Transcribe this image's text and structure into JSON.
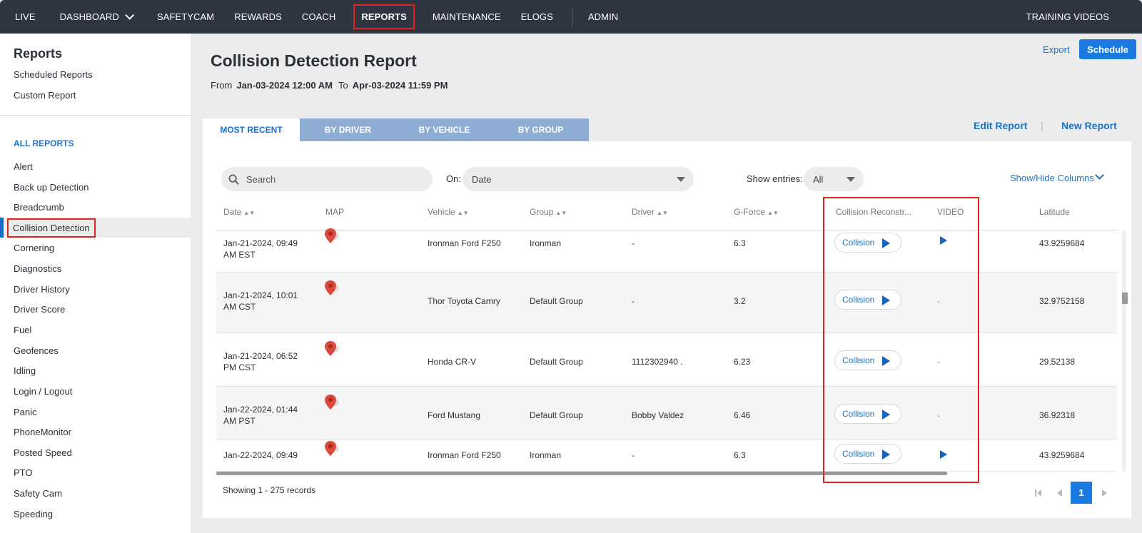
{
  "nav": {
    "items": [
      "LIVE",
      "DASHBOARD",
      "SAFETYCAM",
      "REWARDS",
      "COACH",
      "REPORTS",
      "MAINTENANCE",
      "ELOGS"
    ],
    "admin": "ADMIN",
    "training": "TRAINING VIDEOS",
    "active": "REPORTS"
  },
  "sidebar": {
    "title": "Reports",
    "links": [
      "Scheduled Reports",
      "Custom Report"
    ],
    "section": "ALL REPORTS",
    "items": [
      "Alert",
      "Back up Detection",
      "Breadcrumb",
      "Collision Detection",
      "Cornering",
      "Diagnostics",
      "Driver History",
      "Driver Score",
      "Fuel",
      "Geofences",
      "Idling",
      "Login / Logout",
      "Panic",
      "PhoneMonitor",
      "Posted Speed",
      "PTO",
      "Safety Cam",
      "Speeding"
    ],
    "active": "Collision Detection"
  },
  "header": {
    "title": "Collision Detection Report",
    "from_label": "From",
    "from_value": "Jan-03-2024 12:00 AM",
    "to_label": "To",
    "to_value": "Apr-03-2024 11:59 PM",
    "export": "Export",
    "schedule": "Schedule"
  },
  "tabs": [
    "MOST RECENT",
    "BY DRIVER",
    "BY VEHICLE",
    "BY GROUP"
  ],
  "report_links": {
    "edit": "Edit Report",
    "sep": "|",
    "new": "New Report"
  },
  "filters": {
    "search_placeholder": "Search",
    "on_label": "On:",
    "on_value": "Date",
    "show_label": "Show entries:",
    "show_value": "All",
    "show_hide": "Show/Hide Columns"
  },
  "columns": [
    "Date",
    "MAP",
    "Vehicle",
    "Group",
    "Driver",
    "G-Force",
    "Collision Reconstr...",
    "VIDEO",
    "Latitude"
  ],
  "rows": [
    {
      "date1": "Jan-21-2024, 09:49",
      "date2": "AM EST",
      "vehicle": "Ironman Ford F250",
      "group": "Ironman",
      "driver": "-",
      "gforce": "6.3",
      "collision": "Collision",
      "video": true,
      "lat": "43.9259684"
    },
    {
      "date1": "Jan-21-2024, 10:01",
      "date2": "AM CST",
      "vehicle": "Thor Toyota Camry",
      "group": "Default Group",
      "driver": "-",
      "gforce": "3.2",
      "collision": "Collision",
      "video": false,
      "video_text": "-",
      "lat": "32.9752158"
    },
    {
      "date1": "Jan-21-2024, 06:52",
      "date2": "PM CST",
      "vehicle": "Honda CR-V",
      "group": "Default Group",
      "driver": "1112302940 .",
      "gforce": "6.23",
      "collision": "Collision",
      "video": false,
      "video_text": "-",
      "lat": "29.52138"
    },
    {
      "date1": "Jan-22-2024, 01:44",
      "date2": "AM PST",
      "vehicle": "Ford Mustang",
      "group": "Default Group",
      "driver": "Bobby Valdez",
      "gforce": "6.46",
      "collision": "Collision",
      "video": false,
      "video_text": "-",
      "lat": "36.92318"
    },
    {
      "date1": "Jan-22-2024, 09:49",
      "date2": "",
      "vehicle": "Ironman Ford F250",
      "group": "Ironman",
      "driver": "-",
      "gforce": "6.3",
      "collision": "Collision",
      "video": true,
      "lat": "43.9259684"
    }
  ],
  "footer": {
    "showing": "Showing 1 - 275 records",
    "page": "1"
  },
  "colors": {
    "nav_bg": "#2e3540",
    "accent": "#1a73c9",
    "highlight": "#e0241b",
    "pin": "#d94a3d"
  }
}
